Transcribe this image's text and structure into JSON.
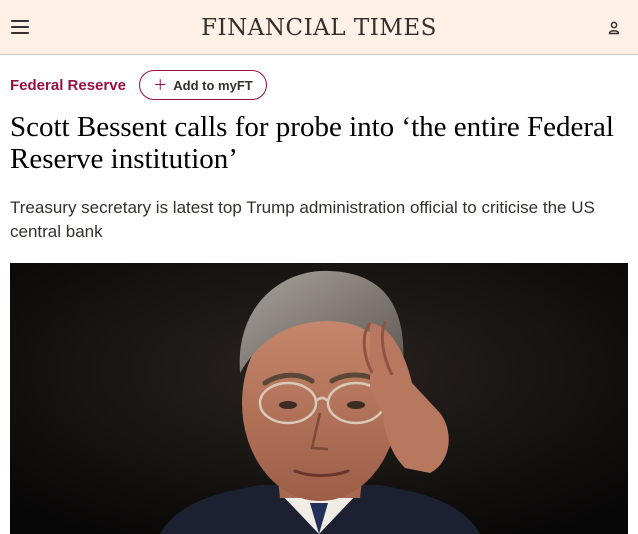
{
  "header": {
    "menu_icon": "hamburger-menu-icon",
    "logo_text": "FINANCIAL TIMES",
    "account_icon": "user-account-icon",
    "background_color": "#fff1e5"
  },
  "topic": {
    "label": "Federal Reserve",
    "color": "#990f3d"
  },
  "myft": {
    "label": "Add to myFT",
    "icon": "plus-icon"
  },
  "article": {
    "headline": "Scott Bessent calls for probe into ‘the entire Federal Reserve institution’",
    "standfirst": "Treasury secretary is latest top Trump administration official to criticise the US central bank",
    "image_subject": "man-adjusting-glasses-photo"
  }
}
